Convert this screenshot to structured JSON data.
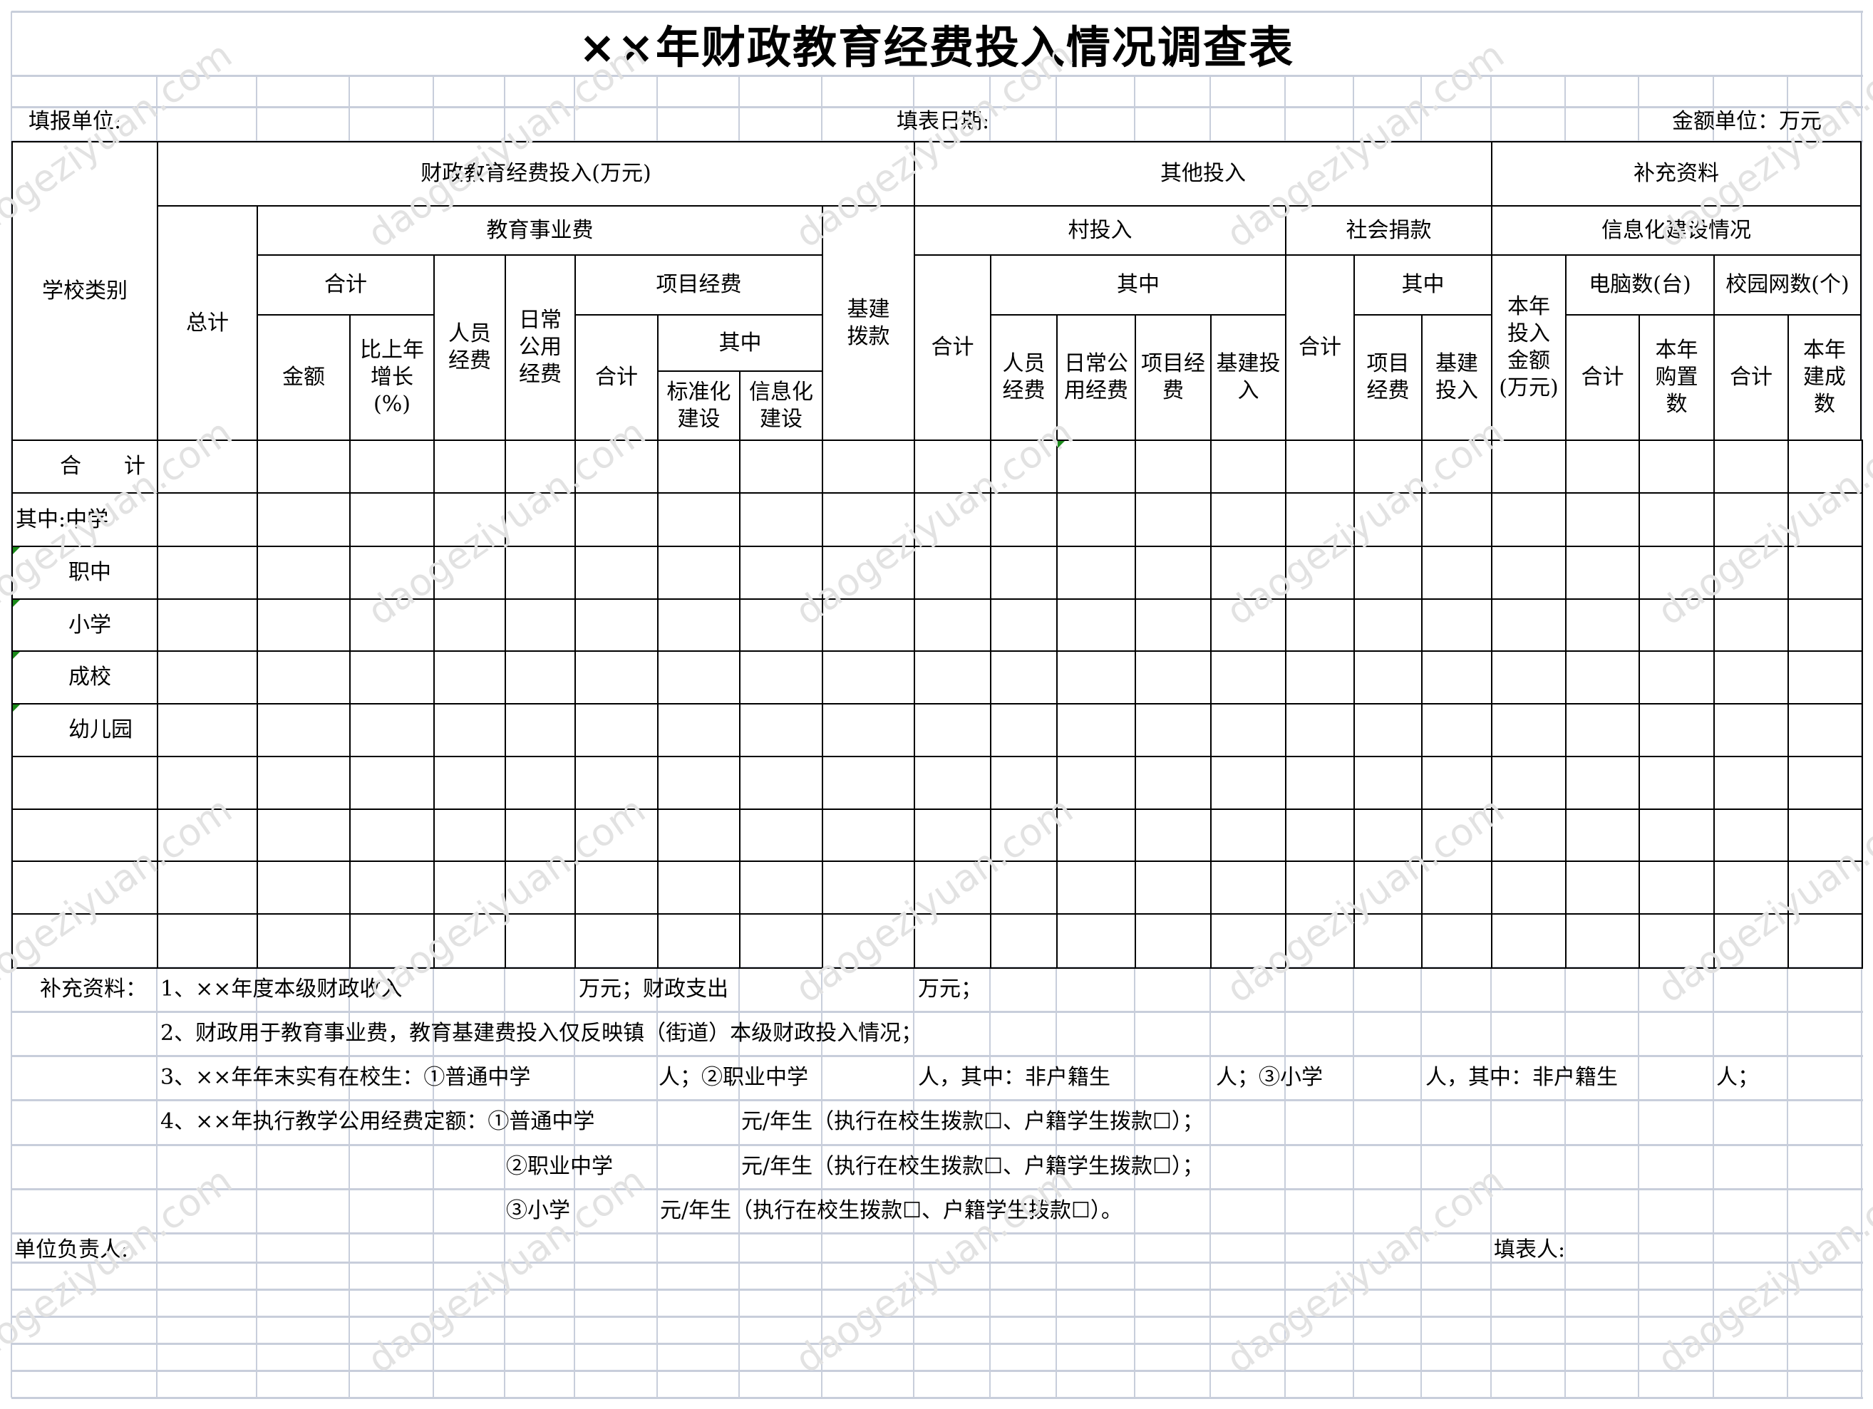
{
  "title": "××年财政教育经费投入情况调查表",
  "info_row": {
    "unit_label": "填报单位:",
    "date_label": "填表日期:",
    "amount_unit_label": "金额单位：万元"
  },
  "header": {
    "school_type": "学校类别",
    "fiscal_group": "财政教育经费投入(万元)",
    "total": "总计",
    "edu_business_fee": "教育事业费",
    "subtotal": "合计",
    "amount": "金额",
    "yoy_growth": "比上年\n增长\n(%)",
    "personnel_fee": "人员\n经费",
    "daily_public_fee": "日常\n公用\n经费",
    "project_fee": "项目经费",
    "project_subtotal": "合计",
    "of_which": "其中",
    "standardization": "标准化\n建设",
    "informatization": "信息化\n建设",
    "capital_allocation": "基建\n拨款",
    "other_input": "其他投入",
    "village_input": "村投入",
    "village_subtotal": "合计",
    "village_of_which": "其中",
    "village_personnel": "人员\n经费",
    "village_daily": "日常公\n用经费",
    "village_project": "项目经\n费",
    "village_capital": "基建投\n入",
    "social_donation": "社会捐款",
    "donation_subtotal": "合计",
    "donation_of_which": "其中",
    "donation_project": "项目\n经费",
    "donation_capital": "基建\n投入",
    "supplementary": "补充资料",
    "info_construction": "信息化建设情况",
    "annual_investment": "本年\n投入\n金额\n(万元)",
    "computers": "电脑数(台)",
    "computers_total": "合计",
    "computers_purchased": "本年\n购置\n数",
    "campus_networks": "校园网数(个)",
    "networks_total": "合计",
    "networks_built": "本年\n建成\n数"
  },
  "rows": [
    {
      "label": "合　　计"
    },
    {
      "label": "其中:中学"
    },
    {
      "label": "职中"
    },
    {
      "label": "小学"
    },
    {
      "label": "成校"
    },
    {
      "label": "幼儿园"
    },
    {
      "label": ""
    },
    {
      "label": ""
    },
    {
      "label": ""
    },
    {
      "label": ""
    }
  ],
  "supplement": {
    "label": "补充资料：",
    "line1": {
      "a": "1、××年度本级财政收入",
      "b": "万元；财政支出",
      "c": "万元；"
    },
    "line2": "2、财政用于教育事业费，教育基建费投入仅反映镇（街道）本级财政投入情况；",
    "line3": {
      "a": "3、××年年末实有在校生：①普通中学",
      "b": "人；②职业中学",
      "c": "人，其中：非户籍生",
      "d": "人；③小学",
      "e": "人，其中：非户籍生",
      "f": "人；"
    },
    "line4": {
      "a": "4、××年执行教学公用经费定额：①普通中学",
      "b": "元/年生（执行在校生拨款☐、户籍学生拨款☐）；"
    },
    "line5": {
      "a": "②职业中学",
      "b": "元/年生（执行在校生拨款☐、户籍学生拨款☐）；"
    },
    "line6": {
      "a": "③小学",
      "b": "元/年生（执行在校生拨款☐、户籍学生拨款☐）。"
    }
  },
  "signature": {
    "unit_head": "单位负责人:",
    "filler": "填表人:"
  },
  "watermark": "daogeziyuan.com",
  "colors": {
    "grid": "#c8cedb",
    "border": "#000000",
    "error_indicator": "#1a8a1a",
    "watermark": "#e2e2e2"
  }
}
